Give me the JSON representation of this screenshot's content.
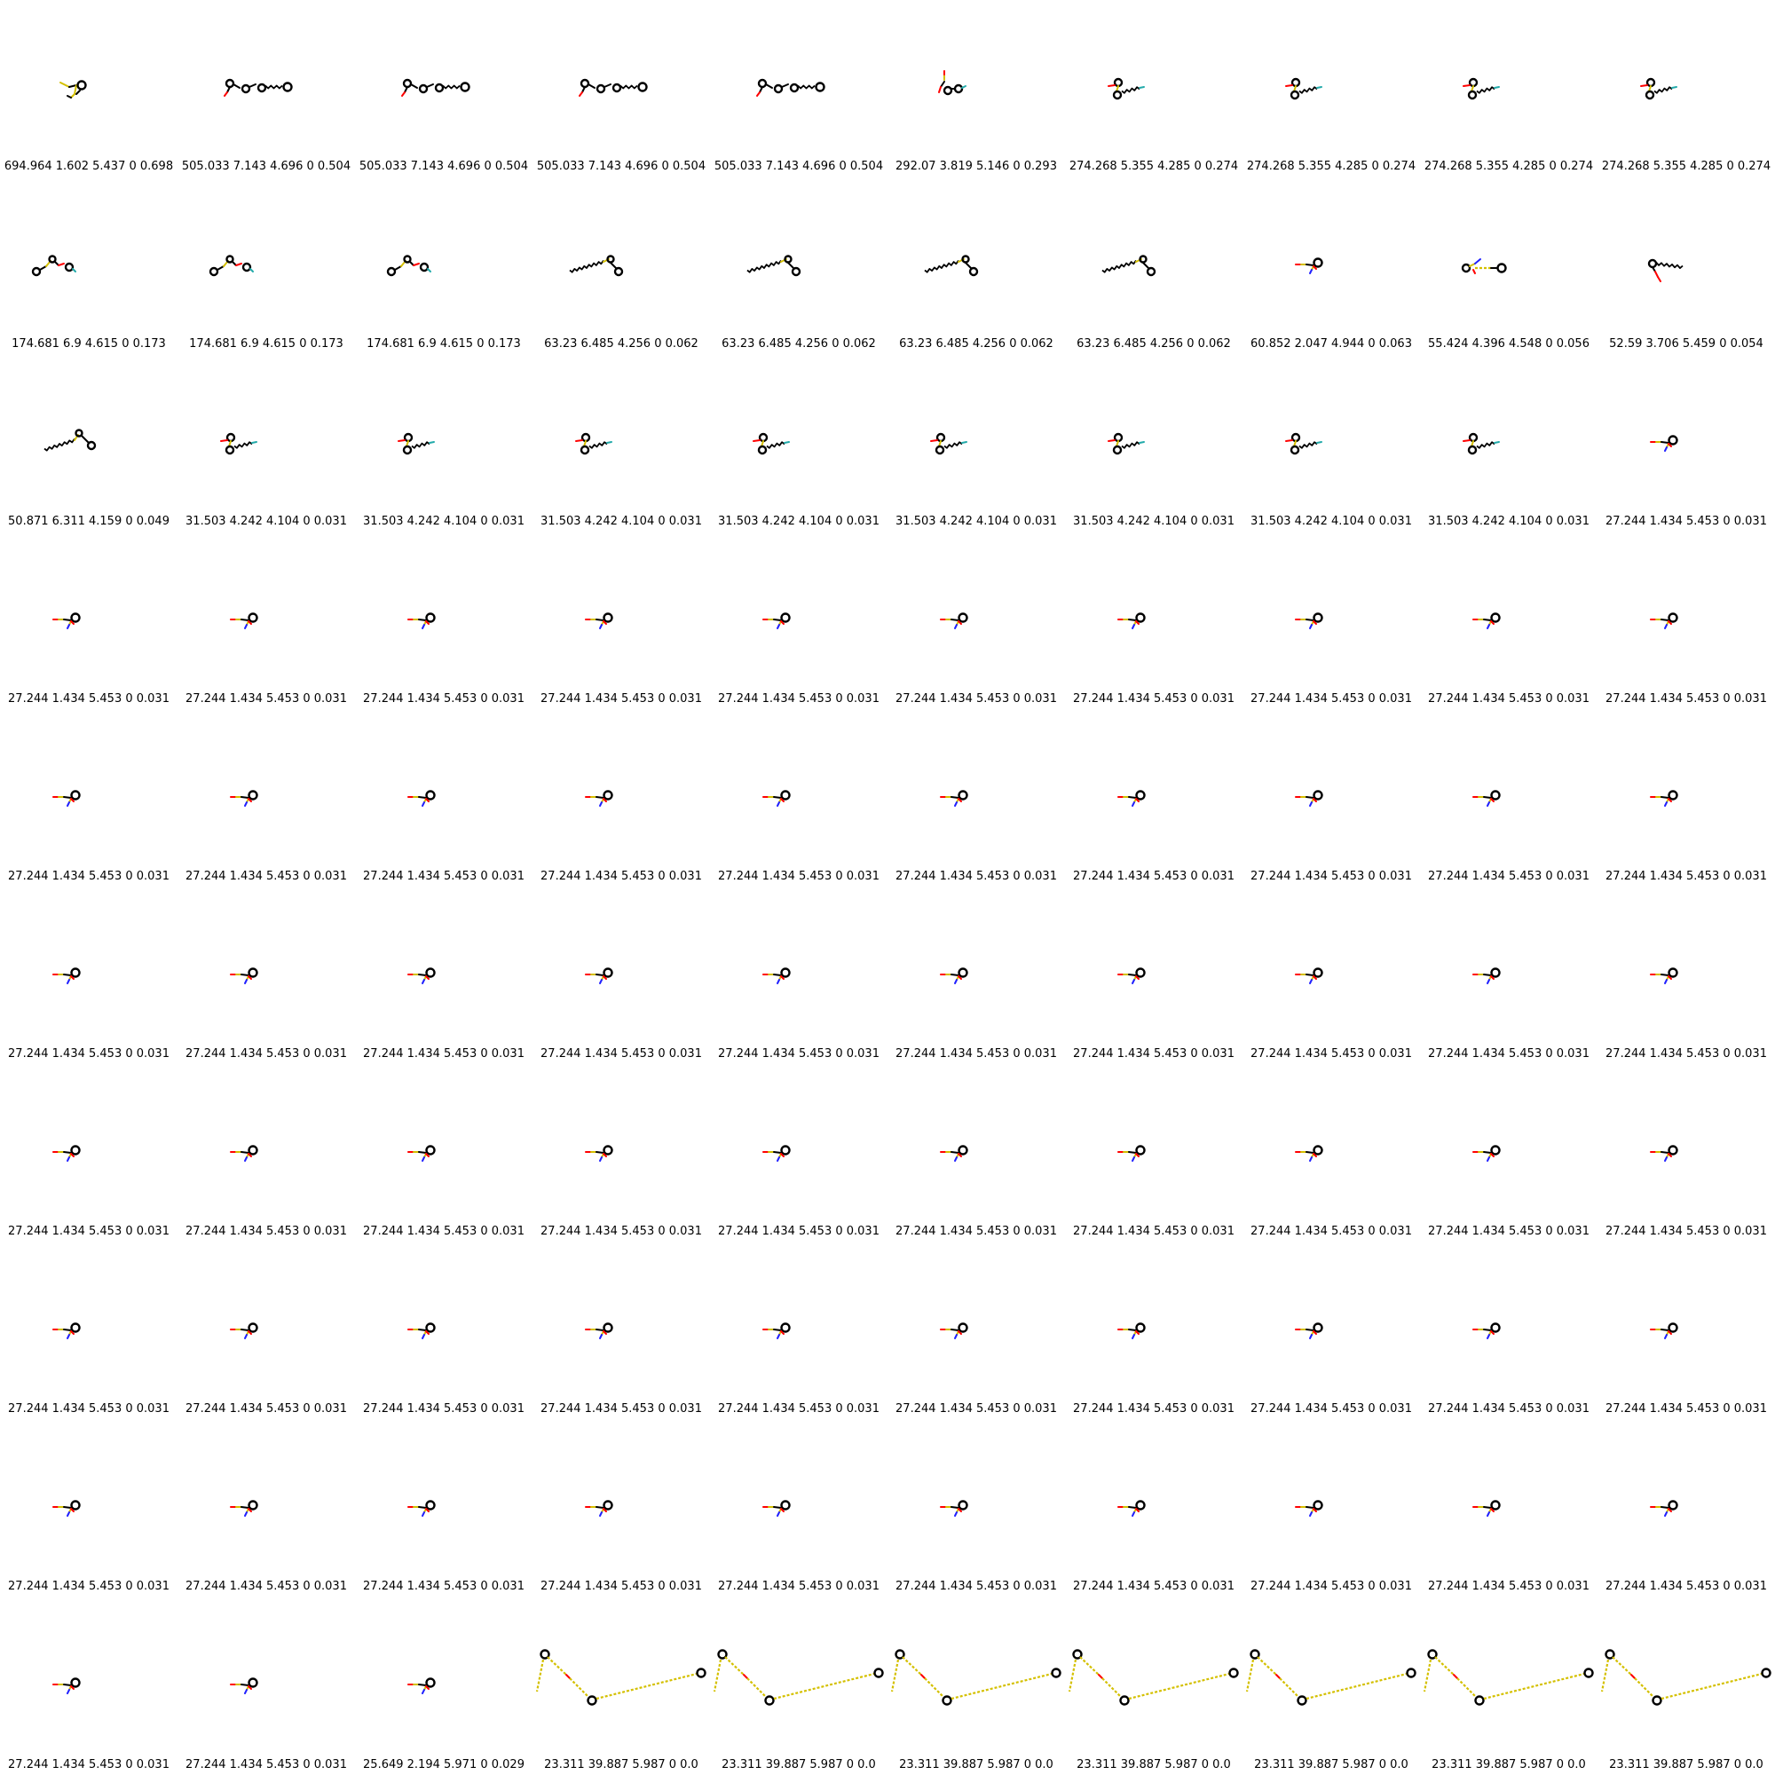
{
  "grid": {
    "columns": 10,
    "cells": [
      {
        "label": "694.964 1.602 5.437 0 0.698",
        "motif": "cluster-a"
      },
      {
        "label": "505.033 7.143 4.696 0 0.504",
        "motif": "chain-rings"
      },
      {
        "label": "505.033 7.143 4.696 0 0.504",
        "motif": "chain-rings"
      },
      {
        "label": "505.033 7.143 4.696 0 0.504",
        "motif": "chain-rings"
      },
      {
        "label": "505.033 7.143 4.696 0 0.504",
        "motif": "chain-rings"
      },
      {
        "label": "292.07 3.819 5.146 0 0.293",
        "motif": "cluster-b"
      },
      {
        "label": "274.268 5.355 4.285 0 0.274",
        "motif": "ring-tail"
      },
      {
        "label": "274.268 5.355 4.285 0 0.274",
        "motif": "ring-tail"
      },
      {
        "label": "274.268 5.355 4.285 0 0.274",
        "motif": "ring-tail"
      },
      {
        "label": "274.268 5.355 4.285 0 0.274",
        "motif": "ring-tail"
      },
      {
        "label": "174.681 6.9 4.615 0 0.173",
        "motif": "zigzag-rings"
      },
      {
        "label": "174.681 6.9 4.615 0 0.173",
        "motif": "zigzag-rings"
      },
      {
        "label": "174.681 6.9 4.615 0 0.173",
        "motif": "zigzag-rings"
      },
      {
        "label": "63.23 6.485 4.256 0 0.062",
        "motif": "long-chain"
      },
      {
        "label": "63.23 6.485 4.256 0 0.062",
        "motif": "long-chain"
      },
      {
        "label": "63.23 6.485 4.256 0 0.062",
        "motif": "long-chain"
      },
      {
        "label": "63.23 6.485 4.256 0 0.062",
        "motif": "long-chain"
      },
      {
        "label": "60.852 2.047 4.944 0 0.063",
        "motif": "small"
      },
      {
        "label": "55.424 4.396 4.548 0 0.056",
        "motif": "two-rings"
      },
      {
        "label": "52.59 3.706 5.459 0 0.054",
        "motif": "ring-down"
      },
      {
        "label": "50.871 6.311 4.159 0 0.049",
        "motif": "long-chain-2"
      },
      {
        "label": "31.503 4.242 4.104 0 0.031",
        "motif": "ring-tail"
      },
      {
        "label": "31.503 4.242 4.104 0 0.031",
        "motif": "ring-tail"
      },
      {
        "label": "31.503 4.242 4.104 0 0.031",
        "motif": "ring-tail"
      },
      {
        "label": "31.503 4.242 4.104 0 0.031",
        "motif": "ring-tail"
      },
      {
        "label": "31.503 4.242 4.104 0 0.031",
        "motif": "ring-tail"
      },
      {
        "label": "31.503 4.242 4.104 0 0.031",
        "motif": "ring-tail"
      },
      {
        "label": "31.503 4.242 4.104 0 0.031",
        "motif": "ring-tail"
      },
      {
        "label": "31.503 4.242 4.104 0 0.031",
        "motif": "ring-tail"
      },
      {
        "label": "27.244 1.434 5.453 0 0.031",
        "motif": "small"
      },
      {
        "label": "27.244 1.434 5.453 0 0.031",
        "motif": "small"
      },
      {
        "label": "27.244 1.434 5.453 0 0.031",
        "motif": "small"
      },
      {
        "label": "27.244 1.434 5.453 0 0.031",
        "motif": "small"
      },
      {
        "label": "27.244 1.434 5.453 0 0.031",
        "motif": "small"
      },
      {
        "label": "27.244 1.434 5.453 0 0.031",
        "motif": "small"
      },
      {
        "label": "27.244 1.434 5.453 0 0.031",
        "motif": "small"
      },
      {
        "label": "27.244 1.434 5.453 0 0.031",
        "motif": "small"
      },
      {
        "label": "27.244 1.434 5.453 0 0.031",
        "motif": "small"
      },
      {
        "label": "27.244 1.434 5.453 0 0.031",
        "motif": "small"
      },
      {
        "label": "27.244 1.434 5.453 0 0.031",
        "motif": "small"
      },
      {
        "label": "27.244 1.434 5.453 0 0.031",
        "motif": "small"
      },
      {
        "label": "27.244 1.434 5.453 0 0.031",
        "motif": "small"
      },
      {
        "label": "27.244 1.434 5.453 0 0.031",
        "motif": "small"
      },
      {
        "label": "27.244 1.434 5.453 0 0.031",
        "motif": "small"
      },
      {
        "label": "27.244 1.434 5.453 0 0.031",
        "motif": "small"
      },
      {
        "label": "27.244 1.434 5.453 0 0.031",
        "motif": "small"
      },
      {
        "label": "27.244 1.434 5.453 0 0.031",
        "motif": "small"
      },
      {
        "label": "27.244 1.434 5.453 0 0.031",
        "motif": "small"
      },
      {
        "label": "27.244 1.434 5.453 0 0.031",
        "motif": "small"
      },
      {
        "label": "27.244 1.434 5.453 0 0.031",
        "motif": "small"
      },
      {
        "label": "27.244 1.434 5.453 0 0.031",
        "motif": "small"
      },
      {
        "label": "27.244 1.434 5.453 0 0.031",
        "motif": "small"
      },
      {
        "label": "27.244 1.434 5.453 0 0.031",
        "motif": "small"
      },
      {
        "label": "27.244 1.434 5.453 0 0.031",
        "motif": "small"
      },
      {
        "label": "27.244 1.434 5.453 0 0.031",
        "motif": "small"
      },
      {
        "label": "27.244 1.434 5.453 0 0.031",
        "motif": "small"
      },
      {
        "label": "27.244 1.434 5.453 0 0.031",
        "motif": "small"
      },
      {
        "label": "27.244 1.434 5.453 0 0.031",
        "motif": "small"
      },
      {
        "label": "27.244 1.434 5.453 0 0.031",
        "motif": "small"
      },
      {
        "label": "27.244 1.434 5.453 0 0.031",
        "motif": "small"
      },
      {
        "label": "27.244 1.434 5.453 0 0.031",
        "motif": "small"
      },
      {
        "label": "27.244 1.434 5.453 0 0.031",
        "motif": "small"
      },
      {
        "label": "27.244 1.434 5.453 0 0.031",
        "motif": "small"
      },
      {
        "label": "27.244 1.434 5.453 0 0.031",
        "motif": "small"
      },
      {
        "label": "27.244 1.434 5.453 0 0.031",
        "motif": "small"
      },
      {
        "label": "27.244 1.434 5.453 0 0.031",
        "motif": "small"
      },
      {
        "label": "27.244 1.434 5.453 0 0.031",
        "motif": "small"
      },
      {
        "label": "27.244 1.434 5.453 0 0.031",
        "motif": "small"
      },
      {
        "label": "27.244 1.434 5.453 0 0.031",
        "motif": "small"
      },
      {
        "label": "27.244 1.434 5.453 0 0.031",
        "motif": "small"
      },
      {
        "label": "27.244 1.434 5.453 0 0.031",
        "motif": "small"
      },
      {
        "label": "27.244 1.434 5.453 0 0.031",
        "motif": "small"
      },
      {
        "label": "27.244 1.434 5.453 0 0.031",
        "motif": "small"
      },
      {
        "label": "27.244 1.434 5.453 0 0.031",
        "motif": "small"
      },
      {
        "label": "27.244 1.434 5.453 0 0.031",
        "motif": "small"
      },
      {
        "label": "27.244 1.434 5.453 0 0.031",
        "motif": "small"
      },
      {
        "label": "27.244 1.434 5.453 0 0.031",
        "motif": "small"
      },
      {
        "label": "27.244 1.434 5.453 0 0.031",
        "motif": "small"
      },
      {
        "label": "27.244 1.434 5.453 0 0.031",
        "motif": "small"
      },
      {
        "label": "27.244 1.434 5.453 0 0.031",
        "motif": "small"
      },
      {
        "label": "27.244 1.434 5.453 0 0.031",
        "motif": "small"
      },
      {
        "label": "27.244 1.434 5.453 0 0.031",
        "motif": "small"
      },
      {
        "label": "27.244 1.434 5.453 0 0.031",
        "motif": "small"
      },
      {
        "label": "27.244 1.434 5.453 0 0.031",
        "motif": "small"
      },
      {
        "label": "27.244 1.434 5.453 0 0.031",
        "motif": "small"
      },
      {
        "label": "27.244 1.434 5.453 0 0.031",
        "motif": "small"
      },
      {
        "label": "27.244 1.434 5.453 0 0.031",
        "motif": "small"
      },
      {
        "label": "27.244 1.434 5.453 0 0.031",
        "motif": "small"
      },
      {
        "label": "27.244 1.434 5.453 0 0.031",
        "motif": "small"
      },
      {
        "label": "27.244 1.434 5.453 0 0.031",
        "motif": "small"
      },
      {
        "label": "27.244 1.434 5.453 0 0.031",
        "motif": "small"
      },
      {
        "label": "27.244 1.434 5.453 0 0.031",
        "motif": "small"
      },
      {
        "label": "25.649 2.194 5.971 0 0.029",
        "motif": "small"
      },
      {
        "label": "23.311 39.887 5.987 0 0.0",
        "motif": "big-v"
      },
      {
        "label": "23.311 39.887 5.987 0 0.0",
        "motif": "big-v"
      },
      {
        "label": "23.311 39.887 5.987 0 0.0",
        "motif": "big-v"
      },
      {
        "label": "23.311 39.887 5.987 0 0.0",
        "motif": "big-v"
      },
      {
        "label": "23.311 39.887 5.987 0 0.0",
        "motif": "big-v"
      },
      {
        "label": "23.311 39.887 5.987 0 0.0",
        "motif": "big-v"
      },
      {
        "label": "23.311 39.887 5.987 0 0.0",
        "motif": "big-v"
      }
    ]
  },
  "colors": {
    "bond": "#000000",
    "sulfur": "#d4c000",
    "oxygen": "#ff0000",
    "nitrogen": "#2020ff",
    "fluorine": "#22aaaa",
    "background": "#ffffff",
    "text": "#000000"
  }
}
